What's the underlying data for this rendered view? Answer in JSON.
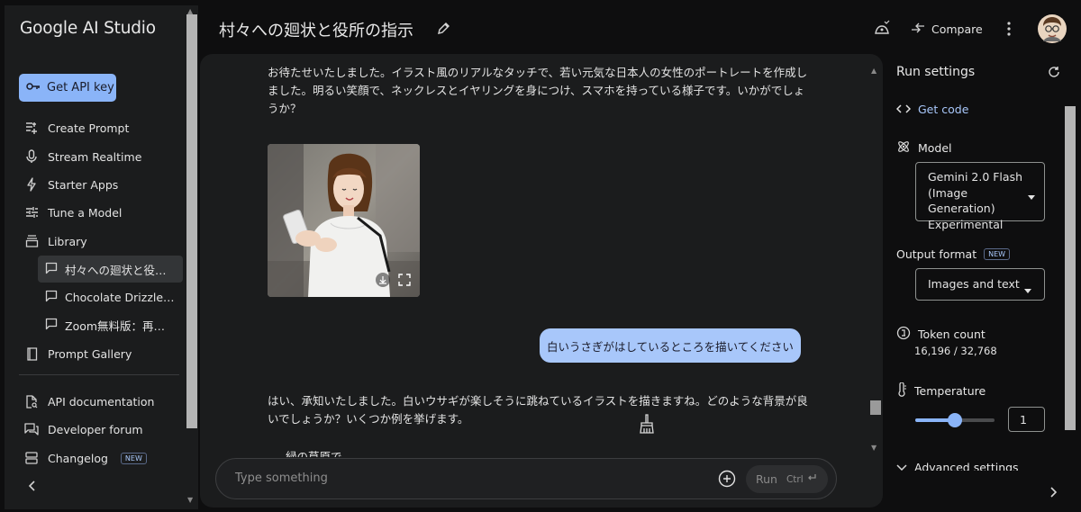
{
  "app": {
    "logo": "Google AI Studio",
    "api_key_label": "Get API key"
  },
  "sidebar": {
    "items": [
      {
        "label": "Create Prompt",
        "icon": "create-prompt-icon"
      },
      {
        "label": "Stream Realtime",
        "icon": "mic-icon"
      },
      {
        "label": "Starter Apps",
        "icon": "bolt-icon"
      },
      {
        "label": "Tune a Model",
        "icon": "tune-icon"
      },
      {
        "label": "Library",
        "icon": "library-icon"
      }
    ],
    "library_items": [
      {
        "label": "村々への廻状と役所の指示",
        "active": true
      },
      {
        "label": "Chocolate Drizzle for Dessert",
        "active": false
      },
      {
        "label": "Zoom無料版：再接続の方法",
        "active": false
      }
    ],
    "prompt_gallery": "Prompt Gallery",
    "api_docs": "API documentation",
    "dev_forum": "Developer forum",
    "changelog": "Changelog",
    "new_badge": "NEW"
  },
  "header": {
    "title": "村々への廻状と役所の指示",
    "compare_label": "Compare"
  },
  "chat": {
    "model_message_1": "お待たせいたしました。イラスト風のリアルなタッチで、若い元気な日本人の女性のポートレートを作成しました。明るい笑顔で、ネックレスとイヤリングを身につけ、スマホを持っている様子です。いかがでしょうか？",
    "user_message": "白いうさぎがはしているところを描いてください",
    "model_message_2": "はい、承知いたしました。白いウサギが楽しそうに跳ねているイラストを描きますね。どのような背景が良いでしょうか？いくつか例を挙げます。",
    "model_message_2_cut": "緑の草原で",
    "placeholder": "Type something",
    "run_label": "Run",
    "run_shortcut": "Ctrl"
  },
  "run_settings": {
    "title": "Run settings",
    "get_code": "Get code",
    "model_label": "Model",
    "model_value": "Gemini 2.0 Flash (Image Generation) Experimental",
    "output_format_label": "Output format",
    "output_format_badge": "NEW",
    "output_format_value": "Images and text",
    "token_count_label": "Token count",
    "token_count_value": "16,196 / 32,768",
    "temperature_label": "Temperature",
    "temperature_value": "1",
    "temperature_fraction": 0.5,
    "advanced_label": "Advanced settings"
  },
  "colors": {
    "accent": "#8ab4f8",
    "bubble": "#a8c7fa",
    "panel": "#1b1c1d"
  }
}
